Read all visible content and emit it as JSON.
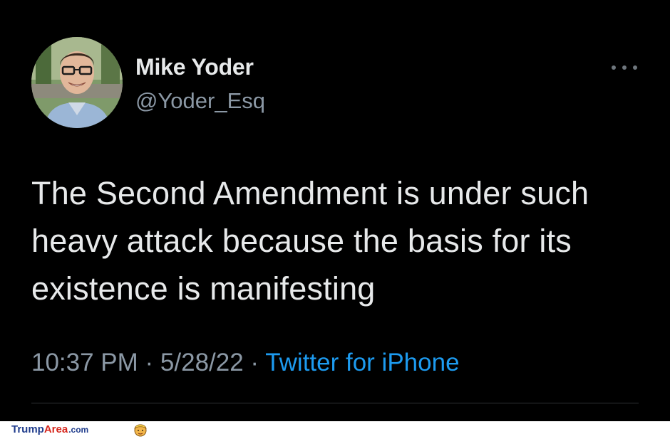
{
  "tweet": {
    "display_name": "Mike Yoder",
    "handle": "@Yoder_Esq",
    "text": "The Second Amendment is under such heavy attack because the basis for its existence is manifesting",
    "time": "10:37 PM",
    "separator_1": " · ",
    "date": "5/28/22",
    "separator_2": " · ",
    "source": "Twitter for iPhone",
    "more_icon": "more-dots-icon"
  },
  "watermark": {
    "brand_part1": "Trump",
    "brand_part2": "Area",
    "brand_suffix": ".com",
    "logo_icon": "trump-face-icon"
  },
  "colors": {
    "background": "#000000",
    "text_primary": "#e7e9ea",
    "text_secondary": "#8b98a5",
    "link": "#1d9bf0",
    "divider": "#2f3336",
    "watermark_blue": "#1f3c8c",
    "watermark_red": "#d6261c"
  }
}
